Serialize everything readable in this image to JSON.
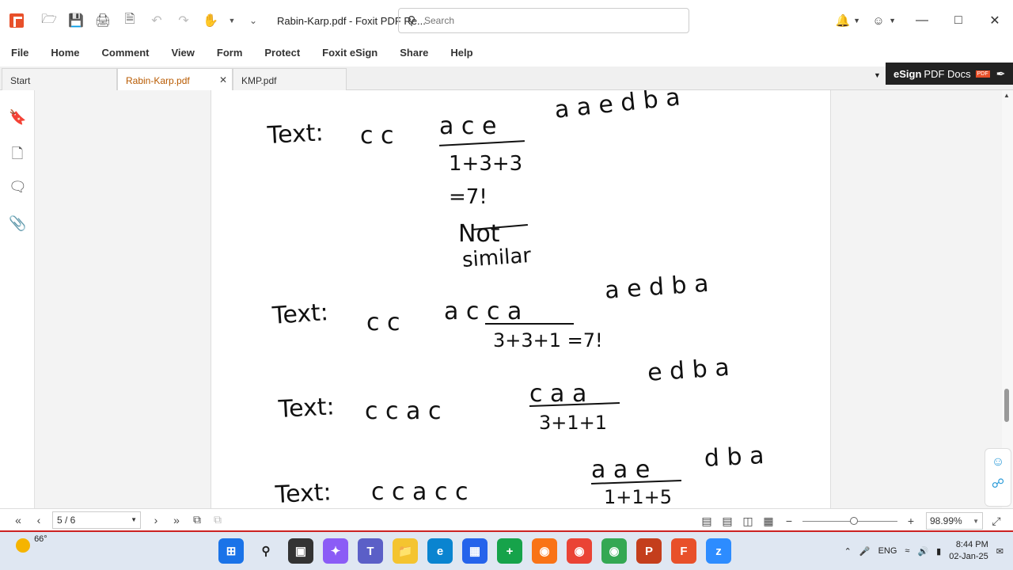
{
  "titlebar": {
    "doc_title": "Rabin-Karp.pdf - Foxit PDF Re...",
    "search_placeholder": "Search"
  },
  "menu": [
    "File",
    "Home",
    "Comment",
    "View",
    "Form",
    "Protect",
    "Foxit eSign",
    "Share",
    "Help"
  ],
  "tabs": [
    {
      "label": "Start"
    },
    {
      "label": "Rabin-Karp.pdf"
    },
    {
      "label": "KMP.pdf"
    }
  ],
  "esign": {
    "brand": "eSign",
    "label": "PDF Docs",
    "badge": "PDF"
  },
  "page": {
    "line1": {
      "prefix": "Text:",
      "chars": "c c",
      "window": "a c e",
      "rest": "a a e d b a"
    },
    "calc1": "1+3+3",
    "calc1b": "=7!",
    "note1a": "Not",
    "note1b": "similar",
    "line2": {
      "prefix": "Text:",
      "chars": "c c",
      "window": "a c c a",
      "rest": "a e d b a"
    },
    "calc2": "3+3+1 =7!",
    "line3": {
      "prefix": "Text:",
      "chars": "c c a c",
      "window": "c a a",
      "rest": "e d b a"
    },
    "calc3": "3+1+1",
    "line4": {
      "prefix": "Text:",
      "chars": "c c a c c",
      "window": "a a e",
      "rest": "d b a"
    },
    "calc4": "1+1+5"
  },
  "statusbar": {
    "page_indicator": "5 / 6",
    "zoom": "98.99%"
  },
  "taskbar": {
    "temperature": "66°",
    "lang": "ENG",
    "time": "8:44 PM",
    "date": "02-Jan-25"
  },
  "colors": {
    "accent": "#e8502a",
    "active_tab_text": "#b85a00",
    "status_border": "#cc2222"
  }
}
